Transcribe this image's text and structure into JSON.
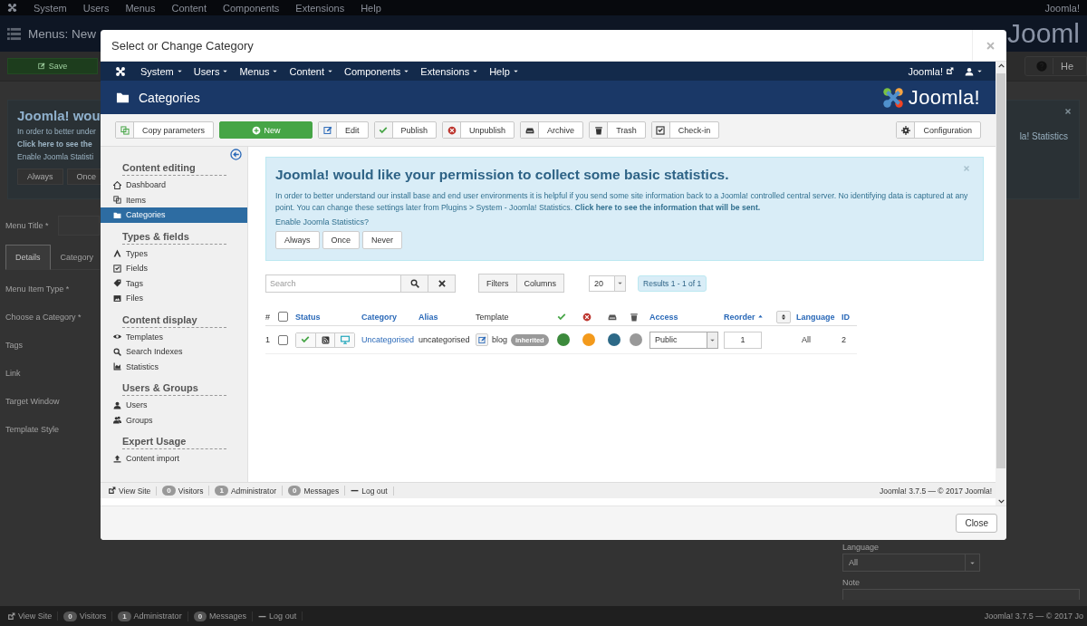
{
  "background": {
    "menu": [
      "System",
      "Users",
      "Menus",
      "Content",
      "Components",
      "Extensions",
      "Help"
    ],
    "site_link": "Joomla!",
    "title": "Menus: New",
    "logo_text": "Jooml",
    "save_button": "Save",
    "help_button": "He",
    "message": {
      "title": "Joomla! wou",
      "text": "In order to better under",
      "link": "Click here to see the",
      "question": "Enable Joomla Statisti",
      "buttons": [
        "Always",
        "Once"
      ],
      "right_text": "la! Statistics"
    },
    "menu_title_label": "Menu Title *",
    "tabs": [
      {
        "label": "Details",
        "selected": true
      },
      {
        "label": "Category",
        "selected": false
      }
    ],
    "form_labels": [
      "Menu Item Type *",
      "Choose a Category *",
      "Tags",
      "Link",
      "Target Window",
      "Template Style"
    ],
    "language": {
      "label": "Language",
      "value": "All"
    },
    "note_label": "Note",
    "status_bar": {
      "items": [
        {
          "kind": "link",
          "label": "View Site"
        },
        {
          "kind": "badge",
          "count": "0",
          "label": "Visitors"
        },
        {
          "kind": "badge",
          "count": "1",
          "label": "Administrator"
        },
        {
          "kind": "badge",
          "count": "0",
          "label": "Messages"
        },
        {
          "kind": "logout",
          "label": "Log out"
        }
      ],
      "copyright": "Joomla! 3.7.5 — © 2017 Jo"
    }
  },
  "modal": {
    "title": "Select or Change Category",
    "close_button": "Close",
    "page": {
      "menu": [
        "System",
        "Users",
        "Menus",
        "Content",
        "Components",
        "Extensions",
        "Help"
      ],
      "site_link": "Joomla!",
      "title": "Categories",
      "logo_text": "Joomla!",
      "toolbar": [
        {
          "label": "Copy parameters",
          "kind": "default"
        },
        {
          "label": "New",
          "kind": "primary"
        },
        {
          "label": "Edit",
          "kind": "default"
        },
        {
          "label": "Publish",
          "kind": "default"
        },
        {
          "label": "Unpublish",
          "kind": "default"
        },
        {
          "label": "Archive",
          "kind": "default"
        },
        {
          "label": "Trash",
          "kind": "default"
        },
        {
          "label": "Check-in",
          "kind": "default"
        }
      ],
      "config_button": "Configuration",
      "sidebar": [
        {
          "heading": "Content editing",
          "items": [
            {
              "label": "Dashboard",
              "selected": false
            },
            {
              "label": "Items",
              "selected": false
            },
            {
              "label": "Categories",
              "selected": true
            }
          ]
        },
        {
          "heading": "Types & fields",
          "items": [
            {
              "label": "Types",
              "selected": false
            },
            {
              "label": "Fields",
              "selected": false
            },
            {
              "label": "Tags",
              "selected": false
            },
            {
              "label": "Files",
              "selected": false
            }
          ]
        },
        {
          "heading": "Content display",
          "items": [
            {
              "label": "Templates",
              "selected": false
            },
            {
              "label": "Search Indexes",
              "selected": false
            },
            {
              "label": "Statistics",
              "selected": false
            }
          ]
        },
        {
          "heading": "Users & Groups",
          "items": [
            {
              "label": "Users",
              "selected": false
            },
            {
              "label": "Groups",
              "selected": false
            }
          ]
        },
        {
          "heading": "Expert Usage",
          "items": [
            {
              "label": "Content import",
              "selected": false
            }
          ]
        }
      ],
      "message": {
        "title": "Joomla! would like your permission to collect some basic statistics.",
        "text": "In order to better understand our install base and end user environments it is helpful if you send some site information back to a Joomla! controlled central server. No identifying data is captured at any point. You can change these settings later from Plugins > System - Joomla! Statistics. **Click here to see the information that will be sent.**",
        "question": "Enable Joomla Statistics?",
        "buttons": [
          "Always",
          "Once",
          "Never"
        ]
      },
      "search": {
        "placeholder": "Search"
      },
      "filter_buttons": [
        "Filters",
        "Columns"
      ],
      "limit": "20",
      "results": "Results 1 - 1 of 1",
      "table": {
        "columns": [
          {
            "kind": "text",
            "label": "#"
          },
          {
            "kind": "checkbox",
            "checked": false
          },
          {
            "kind": "link",
            "label": "Status"
          },
          {
            "kind": "link",
            "label": "Category"
          },
          {
            "kind": "link",
            "label": "Alias"
          },
          {
            "kind": "text",
            "label": "Template"
          },
          {
            "kind": "icon"
          },
          {
            "kind": "icon"
          },
          {
            "kind": "icon"
          },
          {
            "kind": "icon"
          },
          {
            "kind": "link",
            "label": "Access"
          },
          {
            "kind": "sorted",
            "label": "Reorder"
          },
          {
            "kind": "sort-button"
          },
          {
            "kind": "link",
            "label": "Language"
          },
          {
            "kind": "link",
            "label": "ID"
          }
        ],
        "rows": [
          {
            "num": "1",
            "checked": false,
            "published": true,
            "category": "Uncategorised",
            "alias": "uncategorised",
            "template": "blog",
            "template_badge": "inherited",
            "counts": [
              {
                "color": "#3c8a3c"
              },
              {
                "color": "#f39a1c"
              },
              {
                "color": "#2d6987"
              },
              {
                "color": "#999999"
              }
            ],
            "access": "Public",
            "order": "1",
            "language": "All",
            "id": "2"
          }
        ]
      },
      "status_bar": {
        "items": [
          {
            "kind": "link",
            "label": "View Site"
          },
          {
            "kind": "badge",
            "count": "0",
            "label": "Visitors"
          },
          {
            "kind": "badge",
            "count": "1",
            "label": "Administrator"
          },
          {
            "kind": "badge",
            "count": "0",
            "label": "Messages"
          },
          {
            "kind": "logout",
            "label": "Log out"
          }
        ],
        "copyright": "Joomla! 3.7.5 — © 2017 Joomla!"
      }
    }
  }
}
